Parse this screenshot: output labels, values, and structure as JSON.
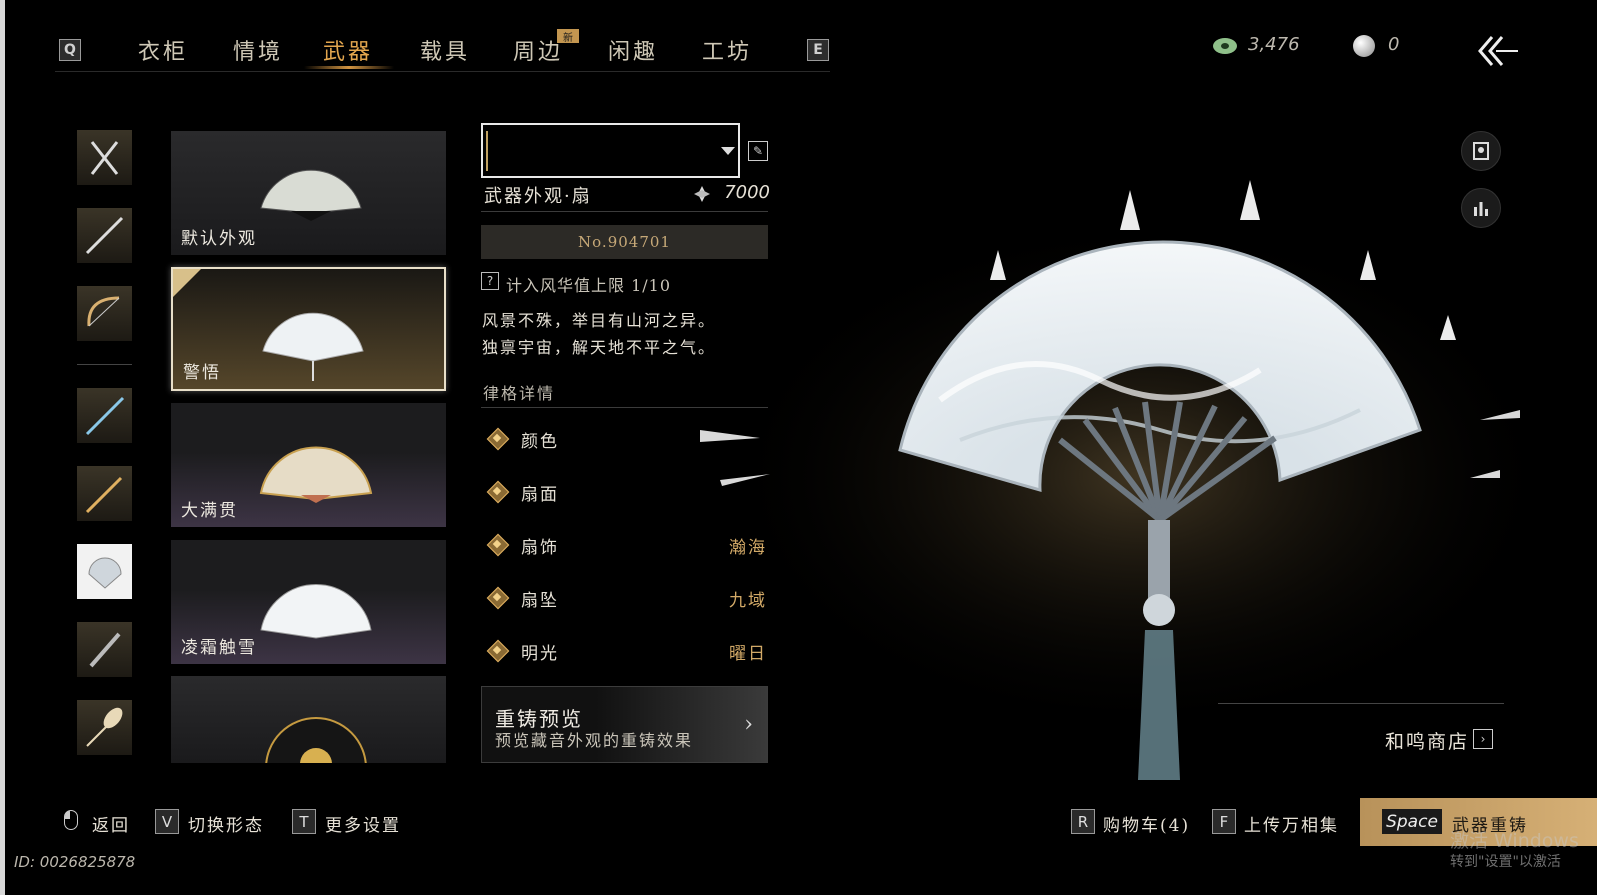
{
  "nav": {
    "prev_key": "Q",
    "next_key": "E",
    "tabs": [
      "衣柜",
      "情境",
      "武器",
      "载具",
      "周边",
      "闲趣",
      "工坊"
    ],
    "active_tab": "武器",
    "new_badge": "新"
  },
  "currency": {
    "jade_amount": "3,476",
    "pearl_amount": "0"
  },
  "side_categories": [
    "dual-blades",
    "spear",
    "bow",
    "sword",
    "halberd",
    "fan",
    "umbrella",
    "feather"
  ],
  "cards": [
    {
      "label": "默认外观"
    },
    {
      "label": "警悟",
      "selected": true
    },
    {
      "label": "大满贯"
    },
    {
      "label": "凌霜触雪"
    },
    {
      "label": ""
    }
  ],
  "detail": {
    "name_value": "",
    "subtitle": "武器外观·扇",
    "price": "7000",
    "serial": "No.904701",
    "help_icon": "?",
    "limit_text": "计入风华值上限 1/10",
    "desc_line1": "风景不殊，举目有山河之异。",
    "desc_line2": "独禀宇宙，解天地不平之气。",
    "section_title": "律格详情",
    "attributes": [
      {
        "name": "颜色",
        "value": ""
      },
      {
        "name": "扇面",
        "value": ""
      },
      {
        "name": "扇饰",
        "value": "瀚海"
      },
      {
        "name": "扇坠",
        "value": "九域"
      },
      {
        "name": "明光",
        "value": "曜日"
      }
    ],
    "reforge_title": "重铸预览",
    "reforge_sub": "预览藏音外观的重铸效果"
  },
  "shop": {
    "label": "和鸣商店"
  },
  "bottom": {
    "back": "返回",
    "switch_key": "V",
    "switch": "切换形态",
    "more_key": "T",
    "more": "更多设置",
    "cart_key": "R",
    "cart": "购物车(4)",
    "upload_key": "F",
    "upload": "上传万相集",
    "space_key": "Space",
    "reforge": "武器重铸",
    "uid": "ID: 0026825878"
  },
  "watermark": {
    "line1": "激活 Windows",
    "line2": "转到\"设置\"以激活"
  },
  "colors": {
    "accent": "#e3a64e",
    "value_gold": "#d2a967",
    "selected_border": "#e8dfc9"
  }
}
